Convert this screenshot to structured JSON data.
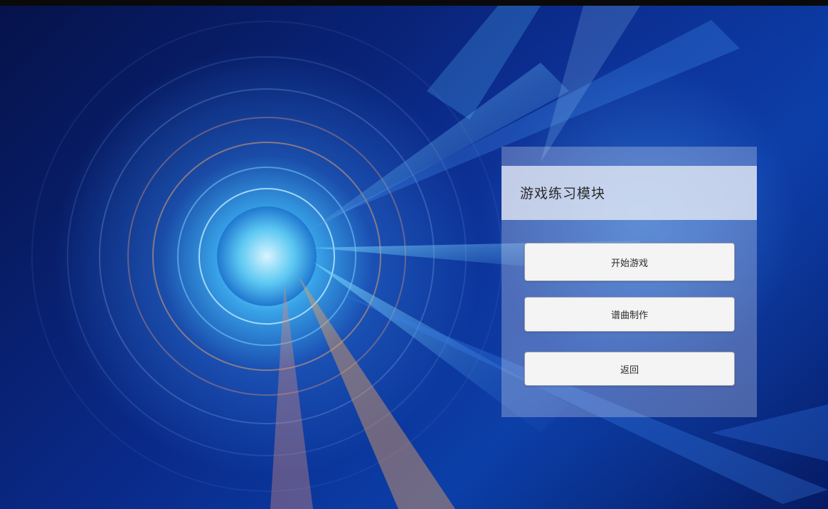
{
  "panel": {
    "title": "游戏练习模块",
    "buttons": {
      "start": "开始游戏",
      "compose": "谱曲制作",
      "back": "返回"
    }
  },
  "colors": {
    "panel_overlay": "rgba(225,230,245,0.30)",
    "button_bg": "#f4f4f4",
    "background_deep": "#06124a",
    "background_glow": "#6fd0f5"
  }
}
